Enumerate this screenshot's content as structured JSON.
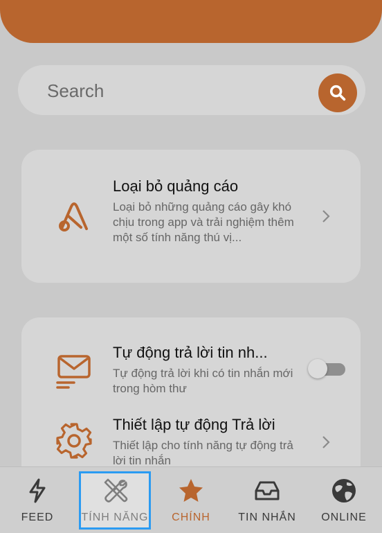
{
  "search": {
    "placeholder": "Search"
  },
  "features": [
    {
      "icon": "ads-a-icon",
      "title": "Loại bỏ quảng cáo",
      "description": "Loại bỏ những quảng cáo gây khó chịu trong app và trải nghiệm thêm một số tính năng thú vị..."
    },
    {
      "icon": "mail-icon",
      "title": "Tự động trả lời tin nh...",
      "description": "Tự động trả lời khi có tin nhắn mới trong hòm thư",
      "toggle": "off"
    },
    {
      "icon": "gear-icon",
      "title": "Thiết lập tự động Trả lời",
      "description": "Thiết lập cho tính năng tự động trả lời tin nhắn"
    }
  ],
  "nav": [
    {
      "label": "FEED",
      "icon": "lightning-icon"
    },
    {
      "label": "TÍNH NĂNG",
      "icon": "tools-icon",
      "highlighted": true
    },
    {
      "label": "CHÍNH",
      "icon": "star-icon",
      "active": true
    },
    {
      "label": "TIN NHẮN",
      "icon": "inbox-icon"
    },
    {
      "label": "ONLINE",
      "icon": "globe-icon"
    }
  ],
  "colors": {
    "accent": "#b8652e",
    "background": "#c9c9c9",
    "card": "#d6d6d6",
    "highlight_border": "#2b9bf2"
  }
}
